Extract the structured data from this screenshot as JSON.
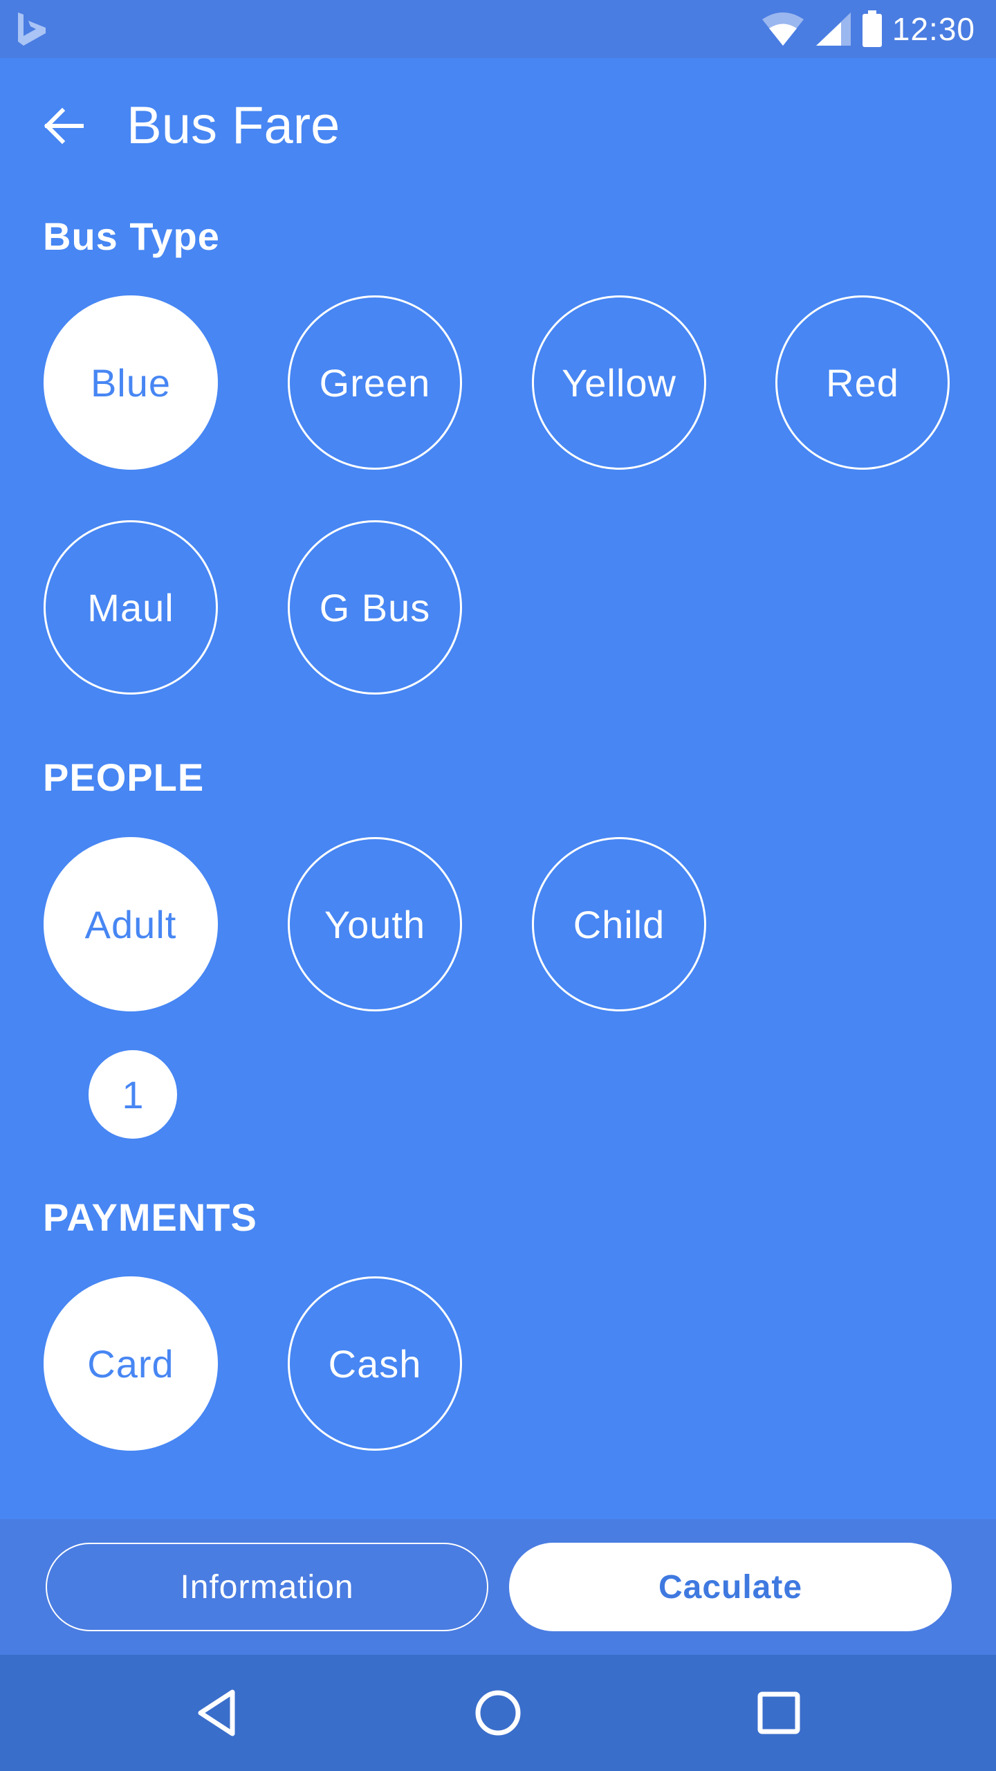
{
  "status_bar": {
    "time": "12:30",
    "icons": [
      "bing-logo-icon",
      "wifi-icon",
      "signal-icon",
      "battery-icon"
    ]
  },
  "header": {
    "title": "Bus Fare",
    "back_icon": "arrow-left-icon"
  },
  "bus_type": {
    "title": "Bus Type",
    "selected": "Blue",
    "options": [
      "Blue",
      "Green",
      "Yellow",
      "Red",
      "Maul",
      "G Bus"
    ]
  },
  "people": {
    "title": "PEOPLE",
    "selected": "Adult",
    "options": [
      "Adult",
      "Youth",
      "Child"
    ],
    "count": "1"
  },
  "payments": {
    "title": "PAYMENTS",
    "selected": "Card",
    "options": [
      "Card",
      "Cash"
    ]
  },
  "actions": {
    "information_label": "Information",
    "calculate_label": "Caculate"
  },
  "nav_bar": {
    "icons": [
      "back-triangle-icon",
      "home-circle-icon",
      "recents-square-icon"
    ]
  },
  "colors": {
    "background": "#4786F3",
    "status_bar": "#4A7DE2",
    "nav_bar": "#3A6ECB",
    "accent_text": "#4786F3",
    "white": "#FFFFFF"
  }
}
